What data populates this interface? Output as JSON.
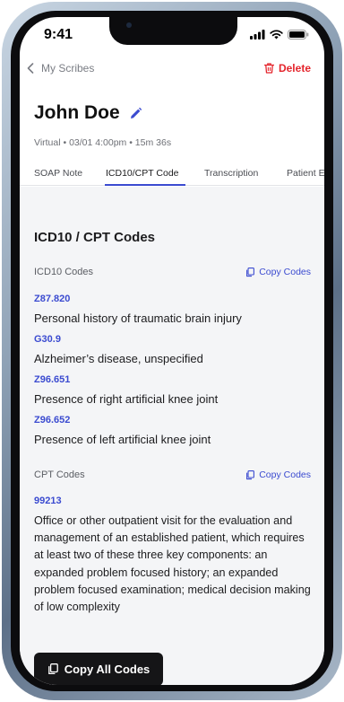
{
  "status_bar": {
    "time": "9:41"
  },
  "nav": {
    "back_label": "My Scribes",
    "delete_label": "Delete"
  },
  "patient": {
    "name": "John Doe",
    "visit_meta": "Virtual • 03/01 4:00pm • 15m 36s"
  },
  "tabs": [
    {
      "label": "SOAP Note",
      "active": false
    },
    {
      "label": "ICD10/CPT Code",
      "active": true
    },
    {
      "label": "Transcription",
      "active": false
    },
    {
      "label": "Patient E",
      "active": false
    }
  ],
  "section_title": "ICD10 / CPT Codes",
  "icd10": {
    "label": "ICD10 Codes",
    "copy_label": "Copy Codes",
    "items": [
      {
        "code": "Z87.820",
        "description": "Personal history of traumatic brain injury"
      },
      {
        "code": "G30.9",
        "description": "Alzheimer’s disease, unspecified"
      },
      {
        "code": "Z96.651",
        "description": "Presence of right artificial knee joint"
      },
      {
        "code": "Z96.652",
        "description": "Presence of left artificial knee joint"
      }
    ]
  },
  "cpt": {
    "label": "CPT Codes",
    "copy_label": "Copy Codes",
    "items": [
      {
        "code": "99213",
        "description": "Office or other outpatient visit for the evaluation and management of an established patient, which requires at least two of these three key components: an expanded problem focused history; an expanded problem focused examination; medical decision making of low complexity"
      }
    ]
  },
  "copy_all_label": "Copy All Codes",
  "colors": {
    "accent": "#3b4bd0",
    "danger": "#e4252c",
    "button_bg": "#151517",
    "content_bg": "#f4f5f7"
  },
  "icons": [
    "chevron-left-icon",
    "trash-icon",
    "pencil-icon",
    "copy-icon",
    "signal-icon",
    "wifi-icon",
    "battery-icon"
  ]
}
